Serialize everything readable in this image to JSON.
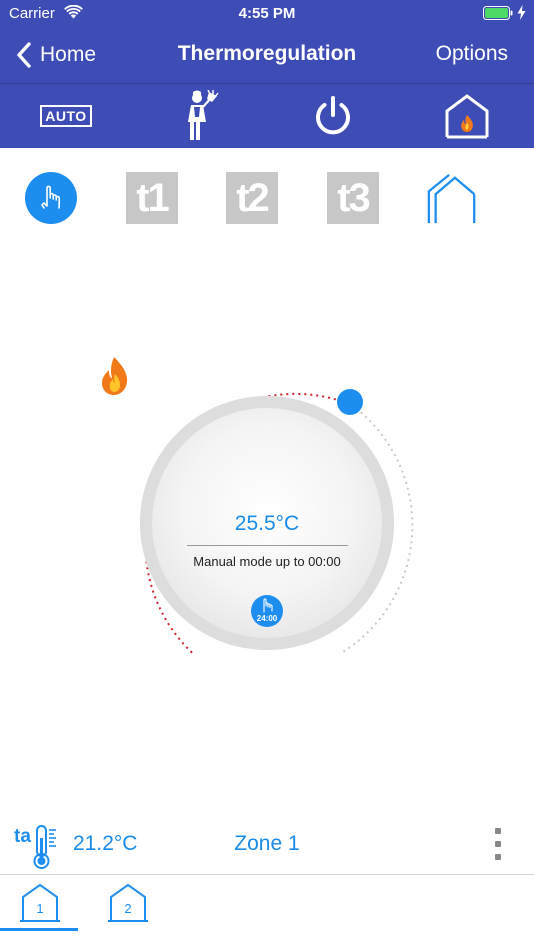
{
  "status_bar": {
    "carrier": "Carrier",
    "time": "4:55 PM"
  },
  "nav": {
    "back_label": "Home",
    "title": "Thermoregulation",
    "options_label": "Options"
  },
  "toolbar": {
    "auto_label": "AUTO",
    "items": [
      "auto-mode-icon",
      "cleaning-lady-icon",
      "power-icon",
      "home-heating-icon"
    ]
  },
  "modes": {
    "items": [
      {
        "name": "manual-mode",
        "icon": "hand-pointer-icon",
        "selected": true
      },
      {
        "name": "t1",
        "label": "t1"
      },
      {
        "name": "t2",
        "label": "t2"
      },
      {
        "name": "t3",
        "label": "t3"
      },
      {
        "name": "antifreeze",
        "icon": "house-outline-icon"
      }
    ]
  },
  "dial": {
    "set_temperature": "25.5°C",
    "mode_text": "Manual mode up to 00:00",
    "badge_time": "24:00",
    "heating_icon": "flame-icon"
  },
  "zone": {
    "current_temperature": "21.2°C",
    "name": "Zone 1"
  },
  "zone_tabs": [
    {
      "label": "1",
      "selected": true
    },
    {
      "label": "2",
      "selected": false
    }
  ],
  "colors": {
    "header_bg": "#3d4db5",
    "accent": "#1d8ef0",
    "accent_text": "#1a8be8",
    "heat_arc": "#d0202a",
    "idle_arc": "#c8c8c8",
    "flame": "#f07a1a",
    "battery": "#4cd964"
  }
}
